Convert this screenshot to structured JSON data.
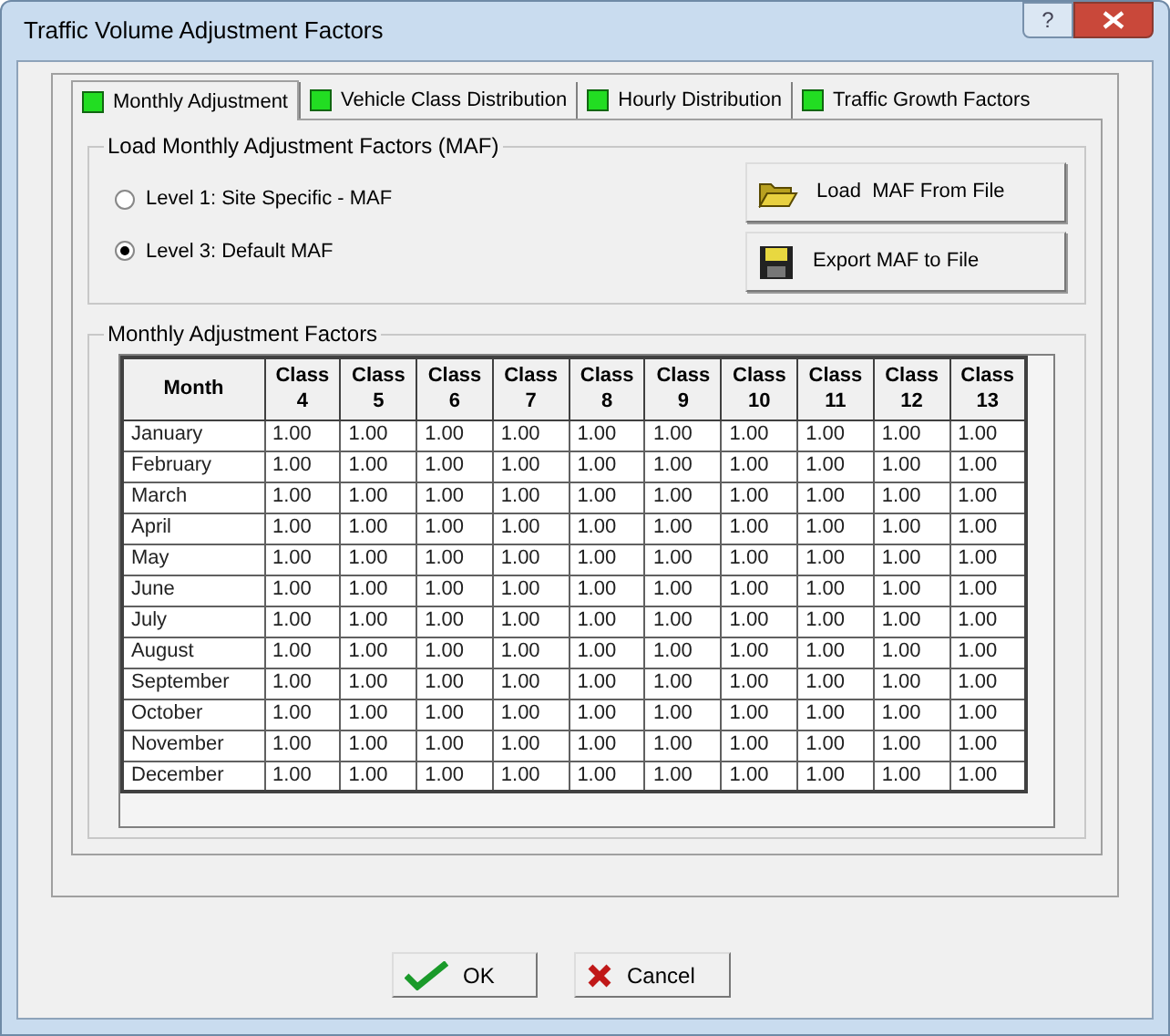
{
  "window": {
    "title": "Traffic Volume Adjustment Factors",
    "help_button": "?"
  },
  "tabs": [
    {
      "label": "Monthly Adjustment",
      "selected": true
    },
    {
      "label": "Vehicle Class Distribution",
      "selected": false
    },
    {
      "label": "Hourly Distribution",
      "selected": false
    },
    {
      "label": "Traffic Growth Factors",
      "selected": false
    }
  ],
  "load_group": {
    "title": "Load Monthly Adjustment Factors (MAF)",
    "options": [
      {
        "label": "Level 1: Site Specific - MAF",
        "selected": false
      },
      {
        "label": "Level 3: Default MAF",
        "selected": true
      }
    ],
    "buttons": [
      {
        "label": "Load  MAF From File",
        "kind": "folder"
      },
      {
        "label": "Export MAF to File",
        "kind": "disk"
      }
    ]
  },
  "factors_group": {
    "title": "Monthly Adjustment Factors",
    "table": {
      "columns": [
        "Month",
        "Class 4",
        "Class 5",
        "Class 6",
        "Class 7",
        "Class 8",
        "Class 9",
        "Class 10",
        "Class 11",
        "Class 12",
        "Class 13"
      ],
      "rows": [
        [
          "January",
          "1.00",
          "1.00",
          "1.00",
          "1.00",
          "1.00",
          "1.00",
          "1.00",
          "1.00",
          "1.00",
          "1.00"
        ],
        [
          "February",
          "1.00",
          "1.00",
          "1.00",
          "1.00",
          "1.00",
          "1.00",
          "1.00",
          "1.00",
          "1.00",
          "1.00"
        ],
        [
          "March",
          "1.00",
          "1.00",
          "1.00",
          "1.00",
          "1.00",
          "1.00",
          "1.00",
          "1.00",
          "1.00",
          "1.00"
        ],
        [
          "April",
          "1.00",
          "1.00",
          "1.00",
          "1.00",
          "1.00",
          "1.00",
          "1.00",
          "1.00",
          "1.00",
          "1.00"
        ],
        [
          "May",
          "1.00",
          "1.00",
          "1.00",
          "1.00",
          "1.00",
          "1.00",
          "1.00",
          "1.00",
          "1.00",
          "1.00"
        ],
        [
          "June",
          "1.00",
          "1.00",
          "1.00",
          "1.00",
          "1.00",
          "1.00",
          "1.00",
          "1.00",
          "1.00",
          "1.00"
        ],
        [
          "July",
          "1.00",
          "1.00",
          "1.00",
          "1.00",
          "1.00",
          "1.00",
          "1.00",
          "1.00",
          "1.00",
          "1.00"
        ],
        [
          "August",
          "1.00",
          "1.00",
          "1.00",
          "1.00",
          "1.00",
          "1.00",
          "1.00",
          "1.00",
          "1.00",
          "1.00"
        ],
        [
          "September",
          "1.00",
          "1.00",
          "1.00",
          "1.00",
          "1.00",
          "1.00",
          "1.00",
          "1.00",
          "1.00",
          "1.00"
        ],
        [
          "October",
          "1.00",
          "1.00",
          "1.00",
          "1.00",
          "1.00",
          "1.00",
          "1.00",
          "1.00",
          "1.00",
          "1.00"
        ],
        [
          "November",
          "1.00",
          "1.00",
          "1.00",
          "1.00",
          "1.00",
          "1.00",
          "1.00",
          "1.00",
          "1.00",
          "1.00"
        ],
        [
          "December",
          "1.00",
          "1.00",
          "1.00",
          "1.00",
          "1.00",
          "1.00",
          "1.00",
          "1.00",
          "1.00",
          "1.00"
        ]
      ]
    }
  },
  "dialog_buttons": [
    {
      "label": "OK",
      "kind": "ok"
    },
    {
      "label": "Cancel",
      "kind": "cancel"
    }
  ]
}
